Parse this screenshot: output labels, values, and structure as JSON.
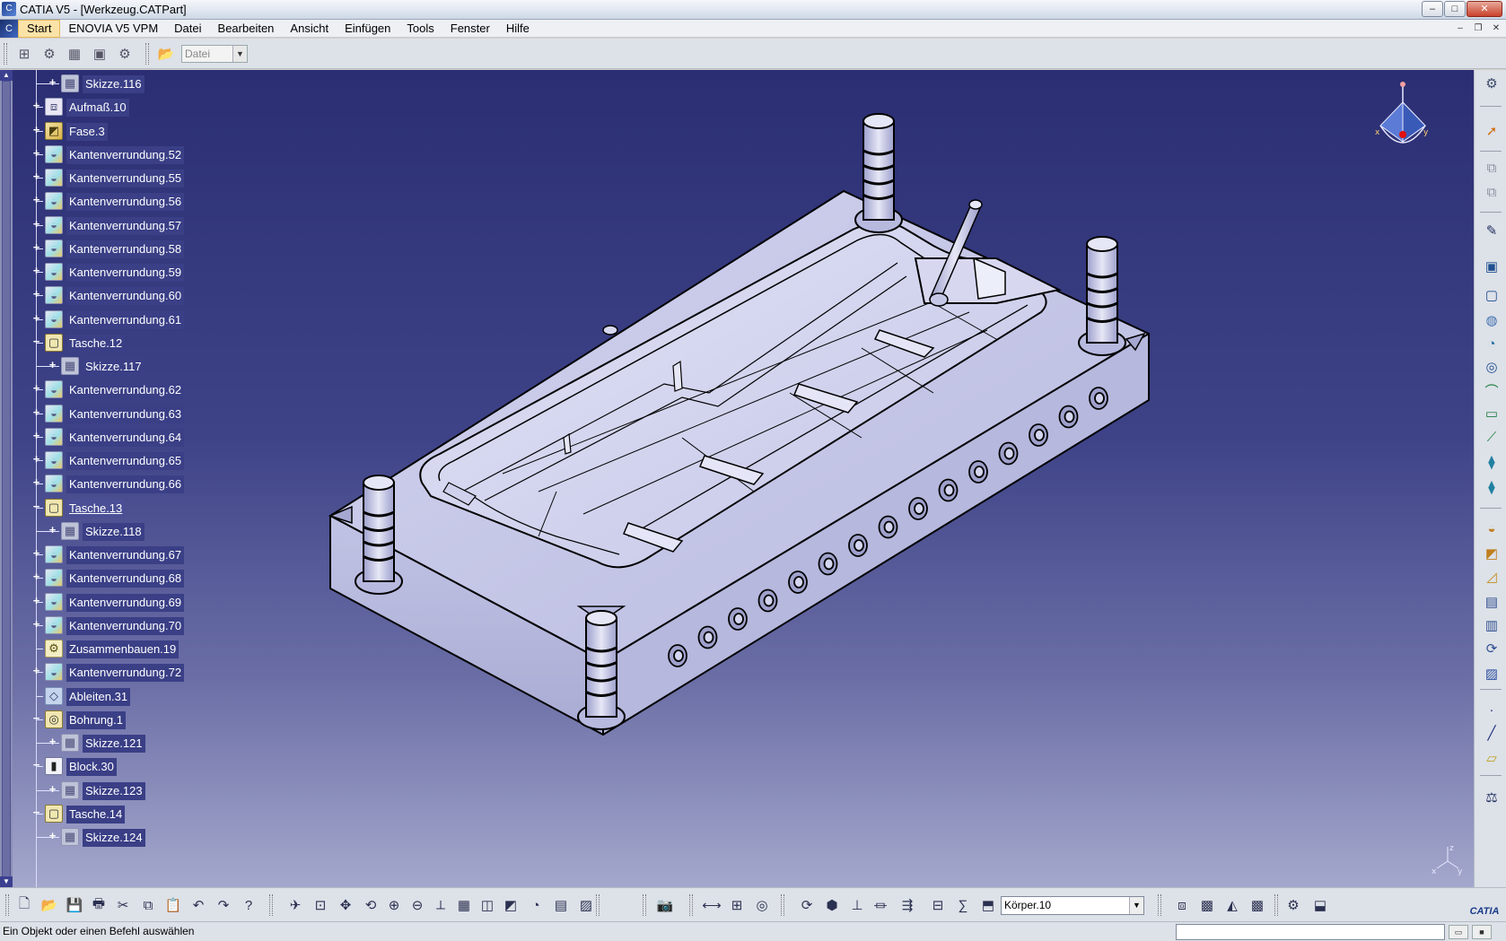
{
  "window": {
    "title": "CATIA V5 - [Werkzeug.CATPart]",
    "controls": {
      "minimize": "–",
      "maximize": "□",
      "close": "✕"
    }
  },
  "menubar": {
    "items": [
      {
        "label": "Start",
        "active": true
      },
      {
        "label": "ENOVIA V5 VPM"
      },
      {
        "label": "Datei"
      },
      {
        "label": "Bearbeiten"
      },
      {
        "label": "Ansicht"
      },
      {
        "label": "Einfügen"
      },
      {
        "label": "Tools"
      },
      {
        "label": "Fenster"
      },
      {
        "label": "Hilfe"
      }
    ],
    "doc_controls": {
      "minimize": "–",
      "restore": "❐",
      "close": "✕"
    }
  },
  "toolbar_top": {
    "file_combo_value": "Datei",
    "icons": [
      "insert-body-icon",
      "hybrid-body-icon",
      "ordered-set-icon",
      "geometry-set-icon",
      "catalog-icon",
      "open-folder-icon"
    ]
  },
  "tree": {
    "nodes": [
      {
        "label": "Skizze.116",
        "type": "sketch",
        "level": 1,
        "expander": "+"
      },
      {
        "label": "Aufmaß.10",
        "type": "draft",
        "level": 0,
        "expander": "+"
      },
      {
        "label": "Fase.3",
        "type": "chamfer",
        "level": 0,
        "expander": "+"
      },
      {
        "label": "Kantenverrundung.52",
        "type": "fillet",
        "level": 0,
        "expander": "+"
      },
      {
        "label": "Kantenverrundung.55",
        "type": "fillet",
        "level": 0,
        "expander": "+"
      },
      {
        "label": "Kantenverrundung.56",
        "type": "fillet",
        "level": 0,
        "expander": "+"
      },
      {
        "label": "Kantenverrundung.57",
        "type": "fillet",
        "level": 0,
        "expander": "+"
      },
      {
        "label": "Kantenverrundung.58",
        "type": "fillet",
        "level": 0,
        "expander": "+"
      },
      {
        "label": "Kantenverrundung.59",
        "type": "fillet",
        "level": 0,
        "expander": "+"
      },
      {
        "label": "Kantenverrundung.60",
        "type": "fillet",
        "level": 0,
        "expander": "+"
      },
      {
        "label": "Kantenverrundung.61",
        "type": "fillet",
        "level": 0,
        "expander": "+"
      },
      {
        "label": "Tasche.12",
        "type": "pocket",
        "level": 0,
        "expander": "−"
      },
      {
        "label": "Skizze.117",
        "type": "sketch",
        "level": 1,
        "expander": "+"
      },
      {
        "label": "Kantenverrundung.62",
        "type": "fillet",
        "level": 0,
        "expander": "+"
      },
      {
        "label": "Kantenverrundung.63",
        "type": "fillet",
        "level": 0,
        "expander": "+"
      },
      {
        "label": "Kantenverrundung.64",
        "type": "fillet",
        "level": 0,
        "expander": "+"
      },
      {
        "label": "Kantenverrundung.65",
        "type": "fillet",
        "level": 0,
        "expander": "+"
      },
      {
        "label": "Kantenverrundung.66",
        "type": "fillet",
        "level": 0,
        "expander": "+"
      },
      {
        "label": "Tasche.13",
        "type": "pocket",
        "level": 0,
        "expander": "−",
        "selected": true
      },
      {
        "label": "Skizze.118",
        "type": "sketch",
        "level": 1,
        "expander": "+"
      },
      {
        "label": "Kantenverrundung.67",
        "type": "fillet",
        "level": 0,
        "expander": "+"
      },
      {
        "label": "Kantenverrundung.68",
        "type": "fillet",
        "level": 0,
        "expander": "+"
      },
      {
        "label": "Kantenverrundung.69",
        "type": "fillet",
        "level": 0,
        "expander": "+"
      },
      {
        "label": "Kantenverrundung.70",
        "type": "fillet",
        "level": 0,
        "expander": "+"
      },
      {
        "label": "Zusammenbauen.19",
        "type": "assemble",
        "level": 0,
        "expander": ""
      },
      {
        "label": "Kantenverrundung.72",
        "type": "fillet",
        "level": 0,
        "expander": "+"
      },
      {
        "label": "Ableiten.31",
        "type": "derive",
        "level": 0,
        "expander": ""
      },
      {
        "label": "Bohrung.1",
        "type": "hole",
        "level": 0,
        "expander": "−"
      },
      {
        "label": "Skizze.121",
        "type": "sketch",
        "level": 1,
        "expander": "+"
      },
      {
        "label": "Block.30",
        "type": "block",
        "level": 0,
        "expander": "−"
      },
      {
        "label": "Skizze.123",
        "type": "sketch",
        "level": 1,
        "expander": "+"
      },
      {
        "label": "Tasche.14",
        "type": "pocket",
        "level": 0,
        "expander": "−"
      },
      {
        "label": "Skizze.124",
        "type": "sketch",
        "level": 1,
        "expander": "+"
      }
    ]
  },
  "toolbar_right": {
    "icons": [
      "settings-gear-icon",
      "select-arrow-icon",
      "copy-paste-icon",
      "paste-special-icon",
      "sketcher-icon",
      "pad-icon",
      "pocket-icon",
      "shaft-icon",
      "groove-icon",
      "hole-icon",
      "rib-icon",
      "slot-icon",
      "stiffener-icon",
      "multi-section-icon",
      "remove-multi-section-icon",
      "fillet-icon",
      "chamfer-icon",
      "draft-icon",
      "shell-icon",
      "thickness-icon",
      "thread-icon",
      "remove-face-icon",
      "point-icon",
      "line-icon",
      "plane-icon",
      "measure-icon"
    ]
  },
  "toolbar_bottom": {
    "body_combo_value": "Körper.10",
    "icons": [
      "new-icon",
      "open-icon",
      "save-icon",
      "print-icon",
      "cut-icon",
      "copy-icon",
      "paste-icon",
      "undo-icon",
      "redo-icon",
      "whats-this-icon",
      "fly-mode-icon",
      "fit-all-icon",
      "pan-icon",
      "rotate-icon",
      "zoom-in-icon",
      "zoom-out-icon",
      "normal-view-icon",
      "multi-view-icon",
      "iso-view-icon",
      "shading-icon",
      "hide-show-icon",
      "swap-space-icon",
      "render-icon",
      "capture-icon",
      "measure-between-icon",
      "measure-item-icon",
      "inertia-icon",
      "update-icon",
      "tools-palette-icon",
      "axis-system-icon",
      "dimension-icon",
      "rule-icon",
      "parameter-icon",
      "formula-icon",
      "body-icon",
      "analysis-icon",
      "draft-analysis-icon",
      "curvature-icon",
      "surface-icon",
      "catalog-icon",
      "workbench-icon"
    ],
    "logo_text": "CATIA"
  },
  "statusbar": {
    "message": "Ein Objekt oder einen Befehl auswählen"
  },
  "colors": {
    "viewport_top": "#2b2e72",
    "viewport_bottom": "#a4a8cc",
    "part_face": "#c7c9e8",
    "part_edge": "#000000",
    "tree_text": "#ffffff"
  }
}
